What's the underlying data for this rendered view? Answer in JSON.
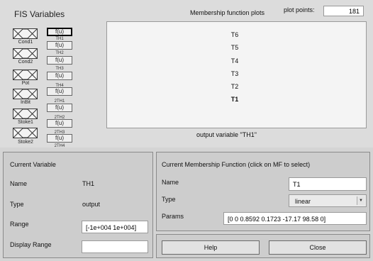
{
  "fis_panel": {
    "title": "FIS Variables",
    "input_labels": [
      "Cond1",
      "Cond2",
      "Pot",
      "InBit",
      "Stoke1",
      "Stoke2"
    ],
    "output_fu_label": "f(u)",
    "output_names": [
      "TH1",
      "TH2",
      "TH3",
      "TH4",
      "2TH1",
      "2TH2",
      "2TH3",
      "2TH4"
    ]
  },
  "plot_header": {
    "title": "Membership function plots",
    "plot_points_label": "plot points:",
    "plot_points_value": "181"
  },
  "mf_plot": {
    "mf_names": [
      "T6",
      "T5",
      "T4",
      "T3",
      "T2",
      "T1"
    ],
    "caption": "output variable \"TH1\""
  },
  "current_variable": {
    "title": "Current Variable",
    "name_label": "Name",
    "name_value": "TH1",
    "type_label": "Type",
    "type_value": "output",
    "range_label": "Range",
    "range_value": "[-1e+004 1e+004]",
    "display_range_label": "Display Range",
    "display_range_value": ""
  },
  "current_mf": {
    "title": "Current Membership Function (click on MF to select)",
    "name_label": "Name",
    "name_value": "T1",
    "type_label": "Type",
    "type_value": "linear",
    "params_label": "Params",
    "params_value": "[0 0 0.8592 0.1723 -17.17 98.58 0]"
  },
  "buttons": {
    "help_label": "Help",
    "close_label": "Close"
  }
}
